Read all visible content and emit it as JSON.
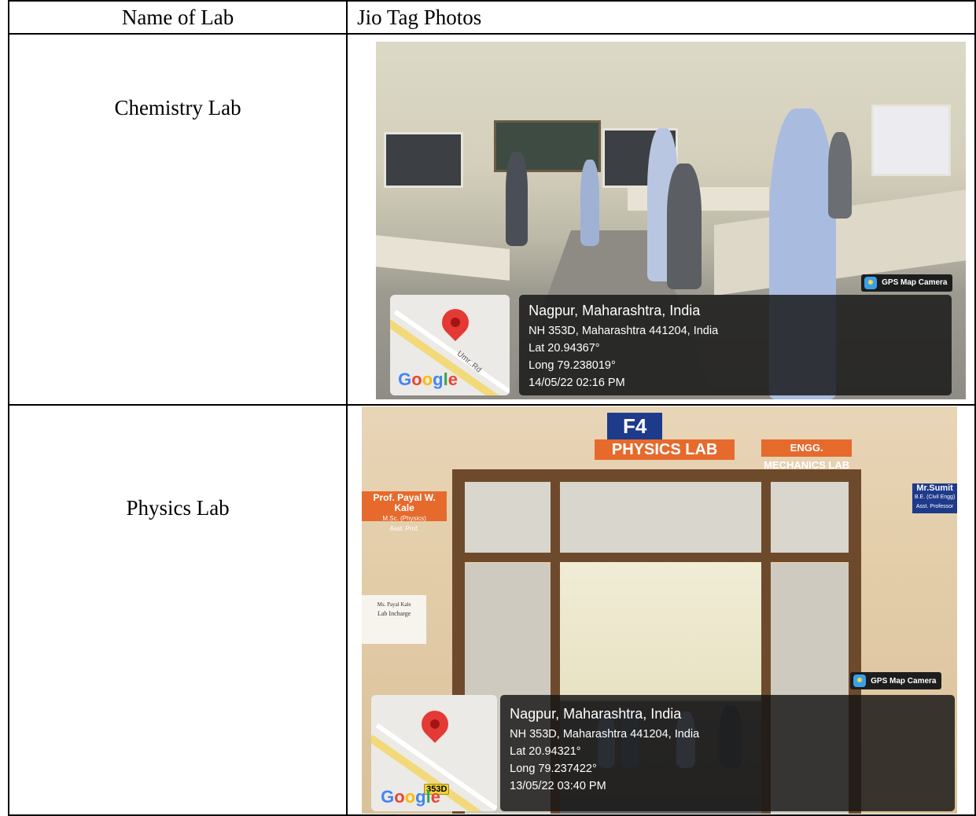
{
  "table": {
    "header_lab": "Name of Lab",
    "header_photos": "Jio Tag Photos"
  },
  "rows": [
    {
      "lab": "Chemistry Lab",
      "gps": {
        "badge": "GPS Map Camera",
        "city": "Nagpur, Maharashtra, India",
        "address": "NH 353D, Maharashtra 441204, India",
        "lat": "Lat 20.94367°",
        "long": "Long 79.238019°",
        "datetime": "14/05/22 02:16 PM",
        "map_road_label": "Umr..Rd"
      }
    },
    {
      "lab": "Physics Lab",
      "signs": {
        "room": "F4",
        "physics": "PHYSICS LAB",
        "mechanics": "ENGG. MECHANICS LAB",
        "prof_name": "Prof. Payal W. Kale",
        "prof_sub1": "M.Sc. (Physics)",
        "prof_sub2": "Asst. Prof.",
        "mr_name": "Mr.Sumit",
        "mr_sub1": "B.E. (Civil Engg)",
        "mr_sub2": "Asst. Professor",
        "paper_line1": "Ms. Payal Kale",
        "paper_line2": "Lab Incharge"
      },
      "gps": {
        "badge": "GPS Map Camera",
        "city": "Nagpur, Maharashtra, India",
        "address": "NH 353D, Maharashtra 441204, India",
        "lat": "Lat 20.94321°",
        "long": "Long 79.237422°",
        "datetime": "13/05/22 03:40 PM",
        "map_shield": "353D"
      }
    }
  ],
  "google_logo": "Google",
  "colors": {
    "gps_overlay": "#141414",
    "pin": "#e53935",
    "sign_orange": "#e66a2c",
    "sign_blue": "#1e3a8a",
    "door_frame": "#6e4a2c"
  }
}
